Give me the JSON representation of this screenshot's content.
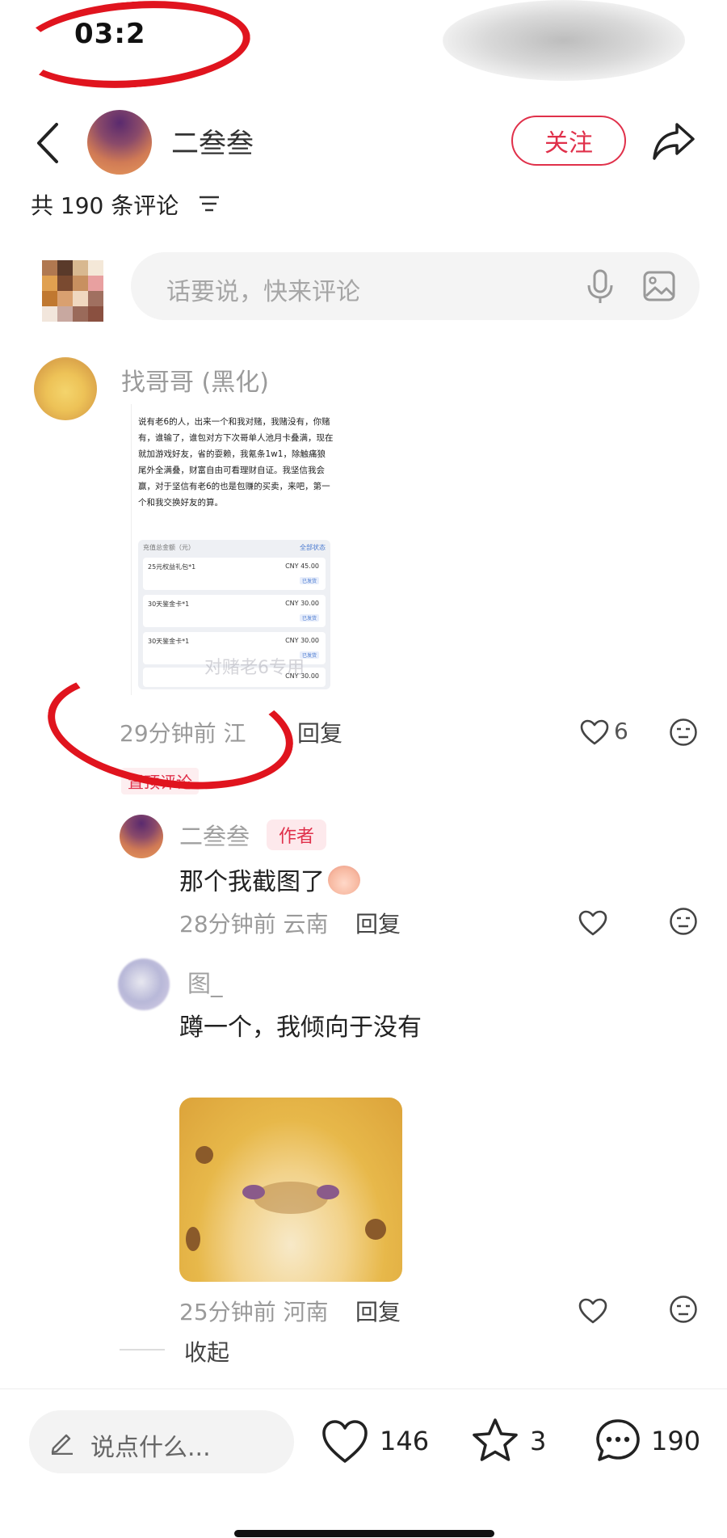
{
  "status_bar": {
    "time": "03:2"
  },
  "header": {
    "author_name": "二叁叁",
    "follow_label": "关注"
  },
  "comments_header": {
    "count_text": "共 190 条评论"
  },
  "comment_input": {
    "placeholder": "话要说，快来评论"
  },
  "main_comment": {
    "username": "找哥哥 (黑化)",
    "image": {
      "text": "说有老6的人，出来一个和我对赌，我赌没有，你赌有，谁输了，谁包对方下次哥单人池月卡叠满，现在就加游戏好友，省的耍赖，我氪条1w1，除触痛狼尾外全满叠，财富自由可看理财自证。我坚信我会赢，对于坚信有老6的也是包赚的买卖，来吧，第一个和我交换好友的算。",
      "header_left": "充值总金额（元）",
      "header_right": "全部状态",
      "rows": [
        {
          "name": "25元权益礼包*1",
          "amount": "CNY 45.00",
          "tag": "已发货"
        },
        {
          "name": "30天鉴金卡*1",
          "amount": "CNY 30.00",
          "tag": "已发货"
        },
        {
          "name": "30天鉴金卡*1",
          "amount": "CNY 30.00",
          "tag": "已发货"
        },
        {
          "name": "",
          "amount": "CNY 30.00",
          "tag": ""
        }
      ],
      "watermark": "对赌老6专用"
    },
    "time_loc": "29分钟前 江",
    "reply_label": "回复",
    "like_count": "6",
    "pinned_label": "置顶评论"
  },
  "replies": [
    {
      "username": "二叁叁",
      "author_tag": "作者",
      "text": "那个我截图了",
      "time_loc": "28分钟前 云南",
      "reply_label": "回复"
    },
    {
      "username": "图_",
      "text": "蹲一个，我倾向于没有",
      "time_loc": "25分钟前 河南",
      "reply_label": "回复"
    }
  ],
  "collapse_label": "收起",
  "bottom_bar": {
    "say_placeholder": "说点什么...",
    "likes": "146",
    "stars": "3",
    "comments": "190"
  },
  "colors": {
    "accent": "#e0304a",
    "scribble": "#e0141e",
    "muted": "#9a9a9a"
  },
  "icons": [
    "back-icon",
    "share-icon",
    "filter-icon",
    "mic-icon",
    "image-icon",
    "heart-icon",
    "face-icon",
    "pencil-icon",
    "star-icon",
    "comment-bubble-icon"
  ]
}
